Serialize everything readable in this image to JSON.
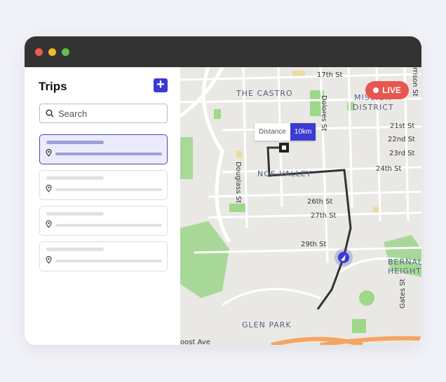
{
  "sidebar": {
    "title": "Trips",
    "add_icon": "plus-icon",
    "search_placeholder": "Search",
    "search_icon": "search-icon",
    "trips": [
      {
        "selected": true
      },
      {
        "selected": false
      },
      {
        "selected": false
      },
      {
        "selected": false
      }
    ]
  },
  "map": {
    "live_label": "LIVE",
    "tooltip": {
      "label": "Distance",
      "value": "10km"
    },
    "streets": [
      "17th St",
      "Dolores St",
      "21st St",
      "22nd St",
      "23rd St",
      "24th St",
      "26th St",
      "27th St",
      "29th St",
      "Douglass St",
      "Gates St",
      "oost Ave",
      "rrison St"
    ],
    "districts": [
      "THE CASTRO",
      "MISSION",
      "DISTRICT",
      "NOE VALLEY",
      "GLEN PARK",
      "BERNAL",
      "HEIGHTS"
    ]
  },
  "colors": {
    "accent": "#3b3bd1",
    "live": "#e8564f",
    "titlebar": "#333333"
  }
}
